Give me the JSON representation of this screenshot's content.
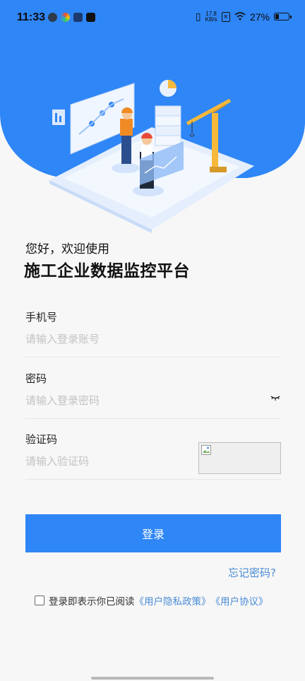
{
  "status_bar": {
    "time": "11:33",
    "net_speed_value": "17.8",
    "net_speed_unit": "KB/s",
    "battery": "27%"
  },
  "hero": {
    "illustration": "construction-data-dashboard-illustration",
    "colors": {
      "blue": "#2f86f6",
      "platform": "#e9f1fd"
    }
  },
  "header": {
    "greeting": "您好，欢迎使用",
    "title": "施工企业数据监控平台"
  },
  "form": {
    "phone": {
      "label": "手机号",
      "placeholder": "请输入登录账号",
      "value": ""
    },
    "password": {
      "label": "密码",
      "placeholder": "请输入登录密码",
      "value": "",
      "toggle_icon": "eye-closed-icon"
    },
    "captcha": {
      "label": "验证码",
      "placeholder": "请输入验证码",
      "value": ""
    }
  },
  "actions": {
    "login_label": "登录",
    "forgot_label": "忘记密码?"
  },
  "agreement": {
    "checked": false,
    "text": "登录即表示你已阅读",
    "privacy_link": "《用户隐私政策》",
    "terms_link": "《用户协议》"
  },
  "colors": {
    "accent": "#2f86f6",
    "link": "#4a8bd6",
    "background": "#f7f7f7"
  }
}
